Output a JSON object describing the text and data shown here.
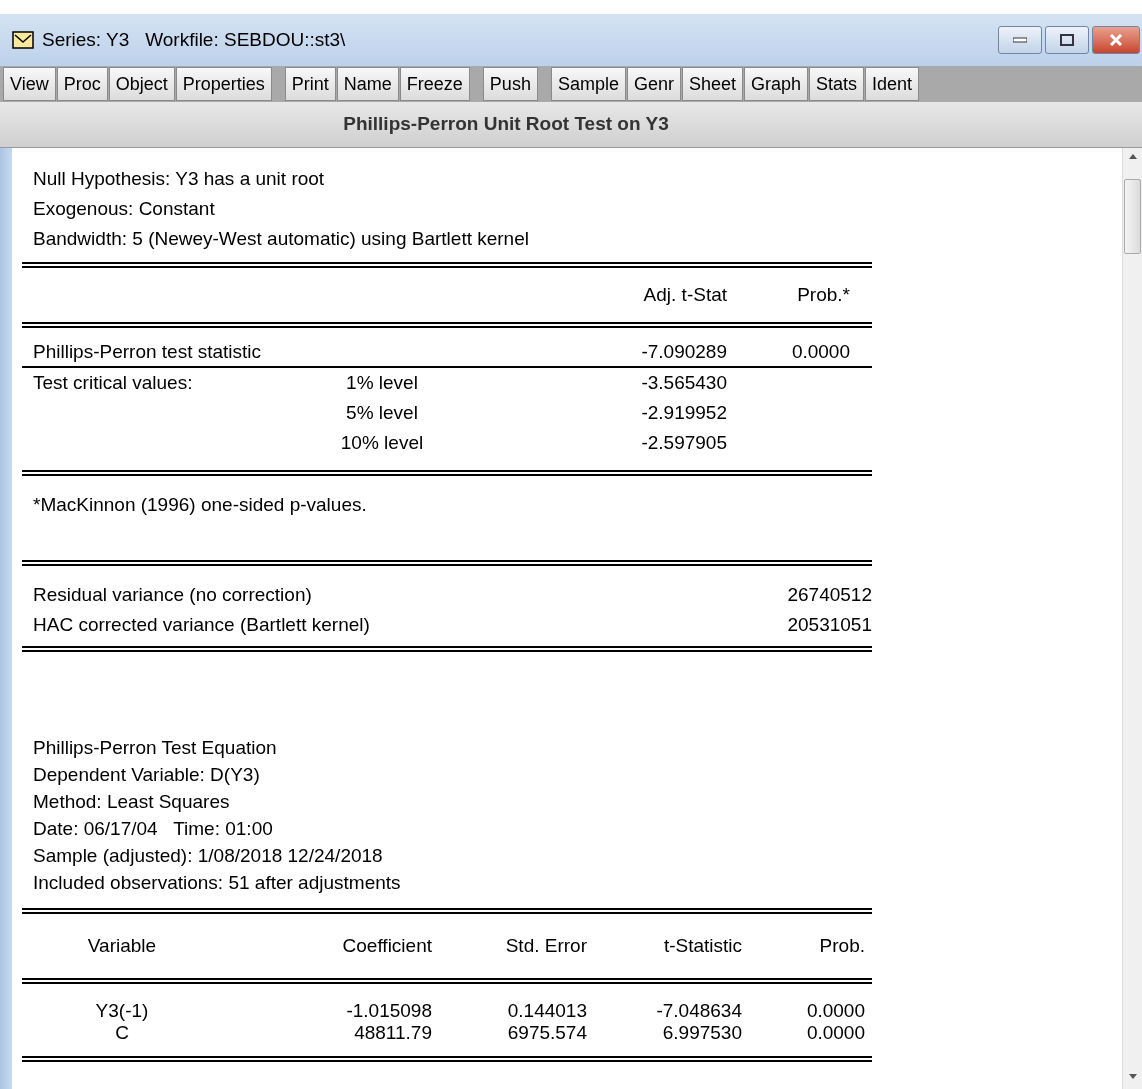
{
  "window": {
    "title": "Series: Y3   Workfile: SEBDOU::st3\\"
  },
  "toolbar": {
    "groups": [
      [
        "View",
        "Proc",
        "Object",
        "Properties"
      ],
      [
        "Print",
        "Name",
        "Freeze"
      ],
      [
        "Push"
      ],
      [
        "Sample",
        "Genr",
        "Sheet",
        "Graph",
        "Stats",
        "Ident"
      ]
    ]
  },
  "view_title": "Phillips-Perron Unit Root Test on Y3",
  "header_lines": [
    "Null Hypothesis: Y3 has a unit root",
    "Exogenous: Constant",
    "Bandwidth: 5 (Newey-West automatic) using Bartlett kernel"
  ],
  "unit_root_table": {
    "columns": [
      "Adj. t-Stat",
      "Prob.*"
    ],
    "rows": [
      {
        "label": "Phillips-Perron test statistic",
        "level": "",
        "adj_t_stat": "-7.090289",
        "prob": "0.0000"
      },
      {
        "label": "Test critical values:",
        "level": "1% level",
        "adj_t_stat": "-3.565430",
        "prob": ""
      },
      {
        "label": "",
        "level": "5% level",
        "adj_t_stat": "-2.919952",
        "prob": ""
      },
      {
        "label": "",
        "level": "10% level",
        "adj_t_stat": "-2.597905",
        "prob": ""
      }
    ]
  },
  "footnote": "*MacKinnon (1996) one-sided p-values.",
  "variance_table": [
    {
      "label": "Residual variance (no correction)",
      "value": "26740512"
    },
    {
      "label": "HAC corrected variance (Bartlett kernel)",
      "value": "20531051"
    }
  ],
  "equation_header": [
    "Phillips-Perron Test Equation",
    "Dependent Variable: D(Y3)",
    "Method: Least Squares",
    "Date: 06/17/04   Time: 01:00",
    "Sample (adjusted): 1/08/2018 12/24/2018",
    "Included observations: 51 after adjustments"
  ],
  "coefficient_table": {
    "columns": [
      "Variable",
      "Coefficient",
      "Std. Error",
      "t-Statistic",
      "Prob."
    ],
    "rows": [
      [
        "Y3(-1)",
        "-1.015098",
        "0.144013",
        "-7.048634",
        "0.0000"
      ],
      [
        "C",
        "48811.79",
        "6975.574",
        "6.997530",
        "0.0000"
      ]
    ]
  }
}
